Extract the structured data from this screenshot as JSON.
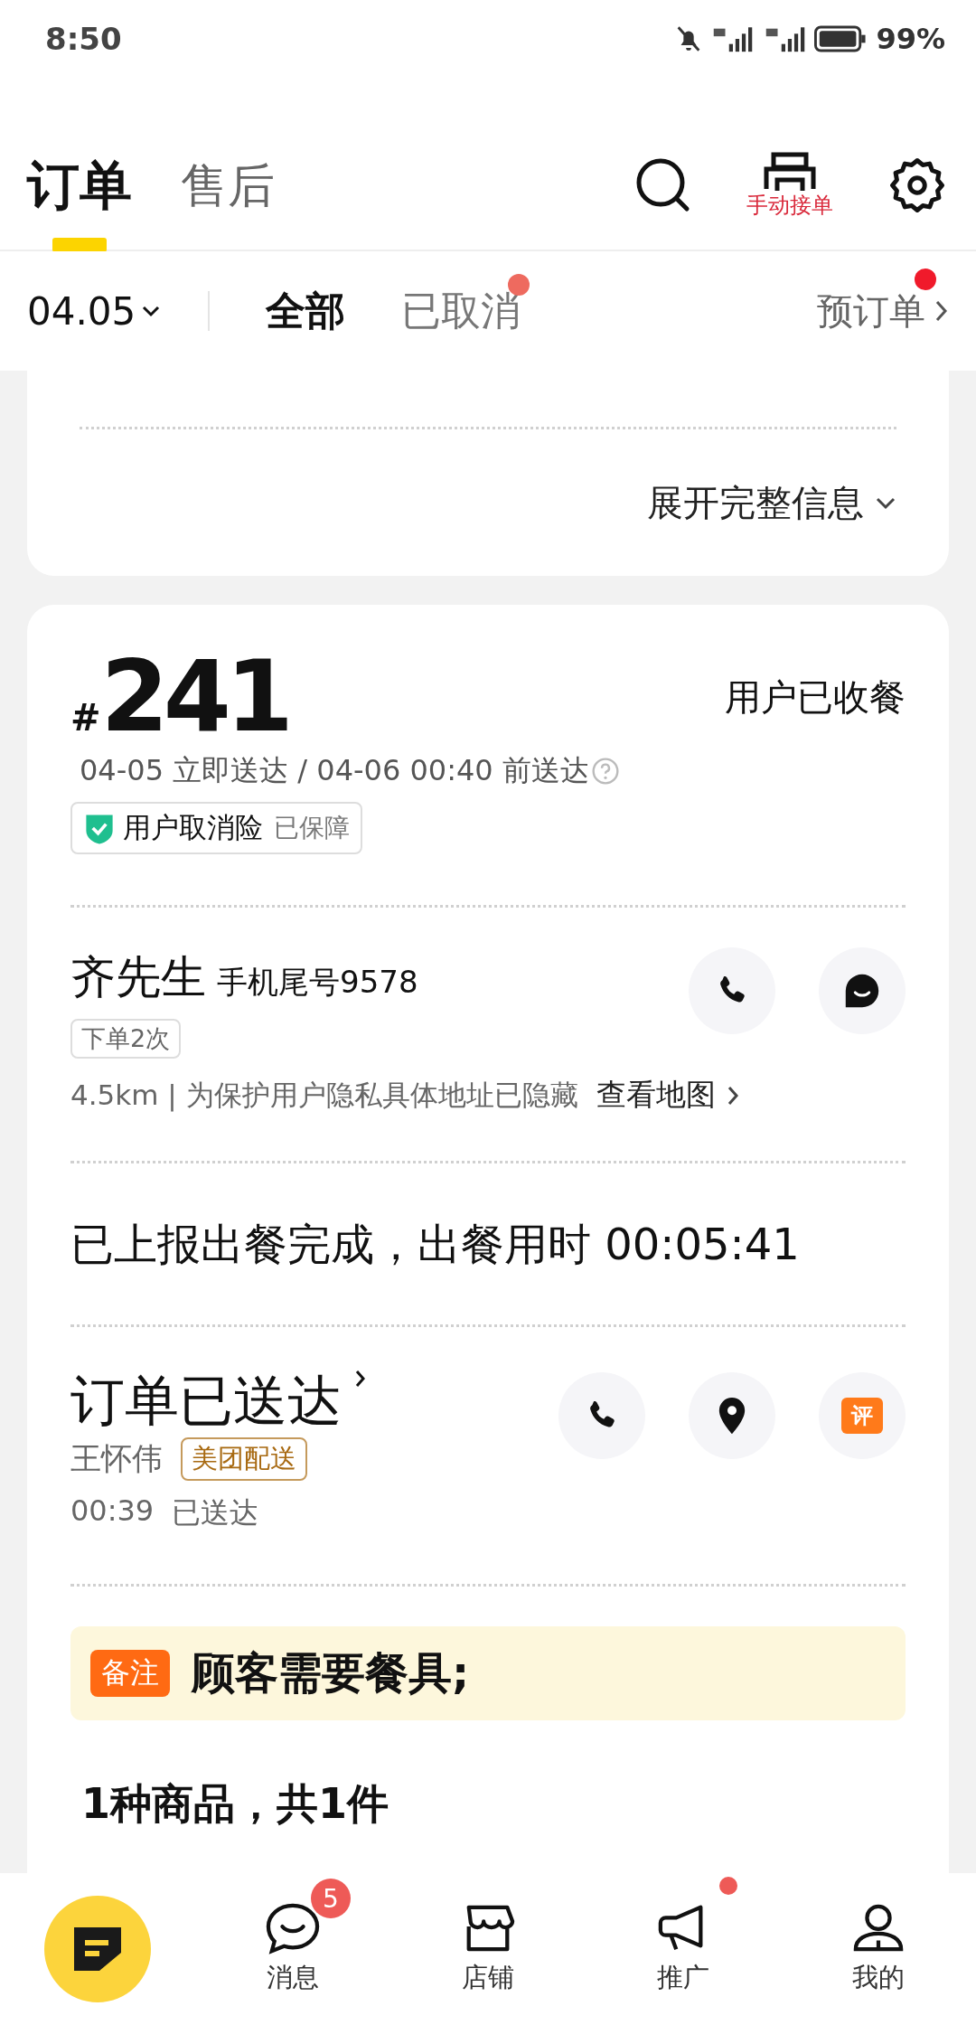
{
  "status_bar": {
    "time": "8:50",
    "battery": "99%"
  },
  "header": {
    "tabs": [
      {
        "label": "订单",
        "selected": true
      },
      {
        "label": "售后",
        "selected": false
      }
    ],
    "print_label": "手动接单"
  },
  "filter_bar": {
    "date": "04.05",
    "tabs": [
      {
        "label": "全部",
        "selected": true,
        "dot": false
      },
      {
        "label": "已取消",
        "selected": false,
        "dot": true
      }
    ],
    "preorder": {
      "label": "预订单",
      "dot": true
    }
  },
  "prev_card": {
    "expand": "展开完整信息"
  },
  "order": {
    "hash": "#",
    "number": "241",
    "status": "用户已收餐",
    "time": "04-05 立即送达 / 04-06 00:40 前送达",
    "insurance": {
      "name": "用户取消险",
      "state": "已保障"
    },
    "customer": {
      "name": "齐先生",
      "phone": "手机尾号9578",
      "tag": "下单2次",
      "distance": "4.5km | 为保护用户隐私具体地址已隐藏",
      "map_link": "查看地图"
    },
    "meal_report": "已上报出餐完成，出餐用时 00:05:41",
    "delivery": {
      "status": "订单已送达",
      "courier": "王怀伟",
      "service": "美团配送",
      "time": "00:39",
      "time_status": "已送达",
      "rate_label": "评"
    },
    "note": {
      "label": "备注",
      "text": "顾客需要餐具;"
    },
    "items_summary": "1种商品，共1件"
  },
  "bottom_nav": [
    {
      "kind": "orders"
    },
    {
      "kind": "messages",
      "label": "消息",
      "badge": "5"
    },
    {
      "kind": "store",
      "label": "店铺"
    },
    {
      "kind": "promote",
      "label": "推广",
      "dot": true
    },
    {
      "kind": "profile",
      "label": "我的"
    }
  ]
}
